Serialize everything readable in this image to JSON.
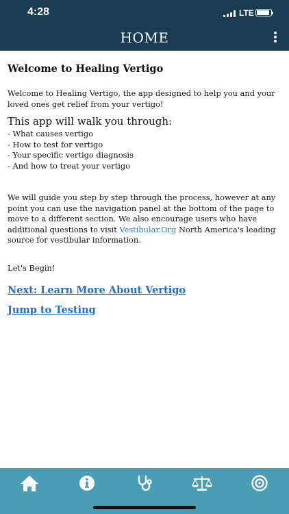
{
  "status_bar": {
    "time": "4:28",
    "network": "LTE",
    "battery_level": 0.9
  },
  "header": {
    "title": "HOME"
  },
  "content": {
    "heading": "Welcome to Healing Vertigo",
    "intro": "Welcome to Healing Vertigo, the app designed to help you and your loved ones get relief from your vertigo!",
    "walk_title": "This app will walk you through:",
    "walk_items": [
      "- What causes vertigo",
      "- How to test for vertigo",
      "- Your specific vertigo diagnosis",
      "- And how to treat your vertigo"
    ],
    "guide_text_before": "We will guide you step by step through the process, however at any point you can use the navigation panel at the bottom of the page to move to a different section. We also encourage users who have additional questions to visit ",
    "guide_link": "Vestibular.Org",
    "guide_text_after": " North America's leading source for vestibular information.",
    "begin": "Let's Begin!",
    "next_link": "Next: Learn More About Vertigo",
    "jump_link": "Jump to Testing"
  },
  "tabbar": {
    "icons": [
      "home-icon",
      "info-icon",
      "stethoscope-icon",
      "scales-icon",
      "target-icon"
    ],
    "color": "#4a9db5"
  },
  "colors": {
    "header": "#1a3c52",
    "link": "#1f6fd1",
    "inline_link": "#2c7bb6"
  }
}
